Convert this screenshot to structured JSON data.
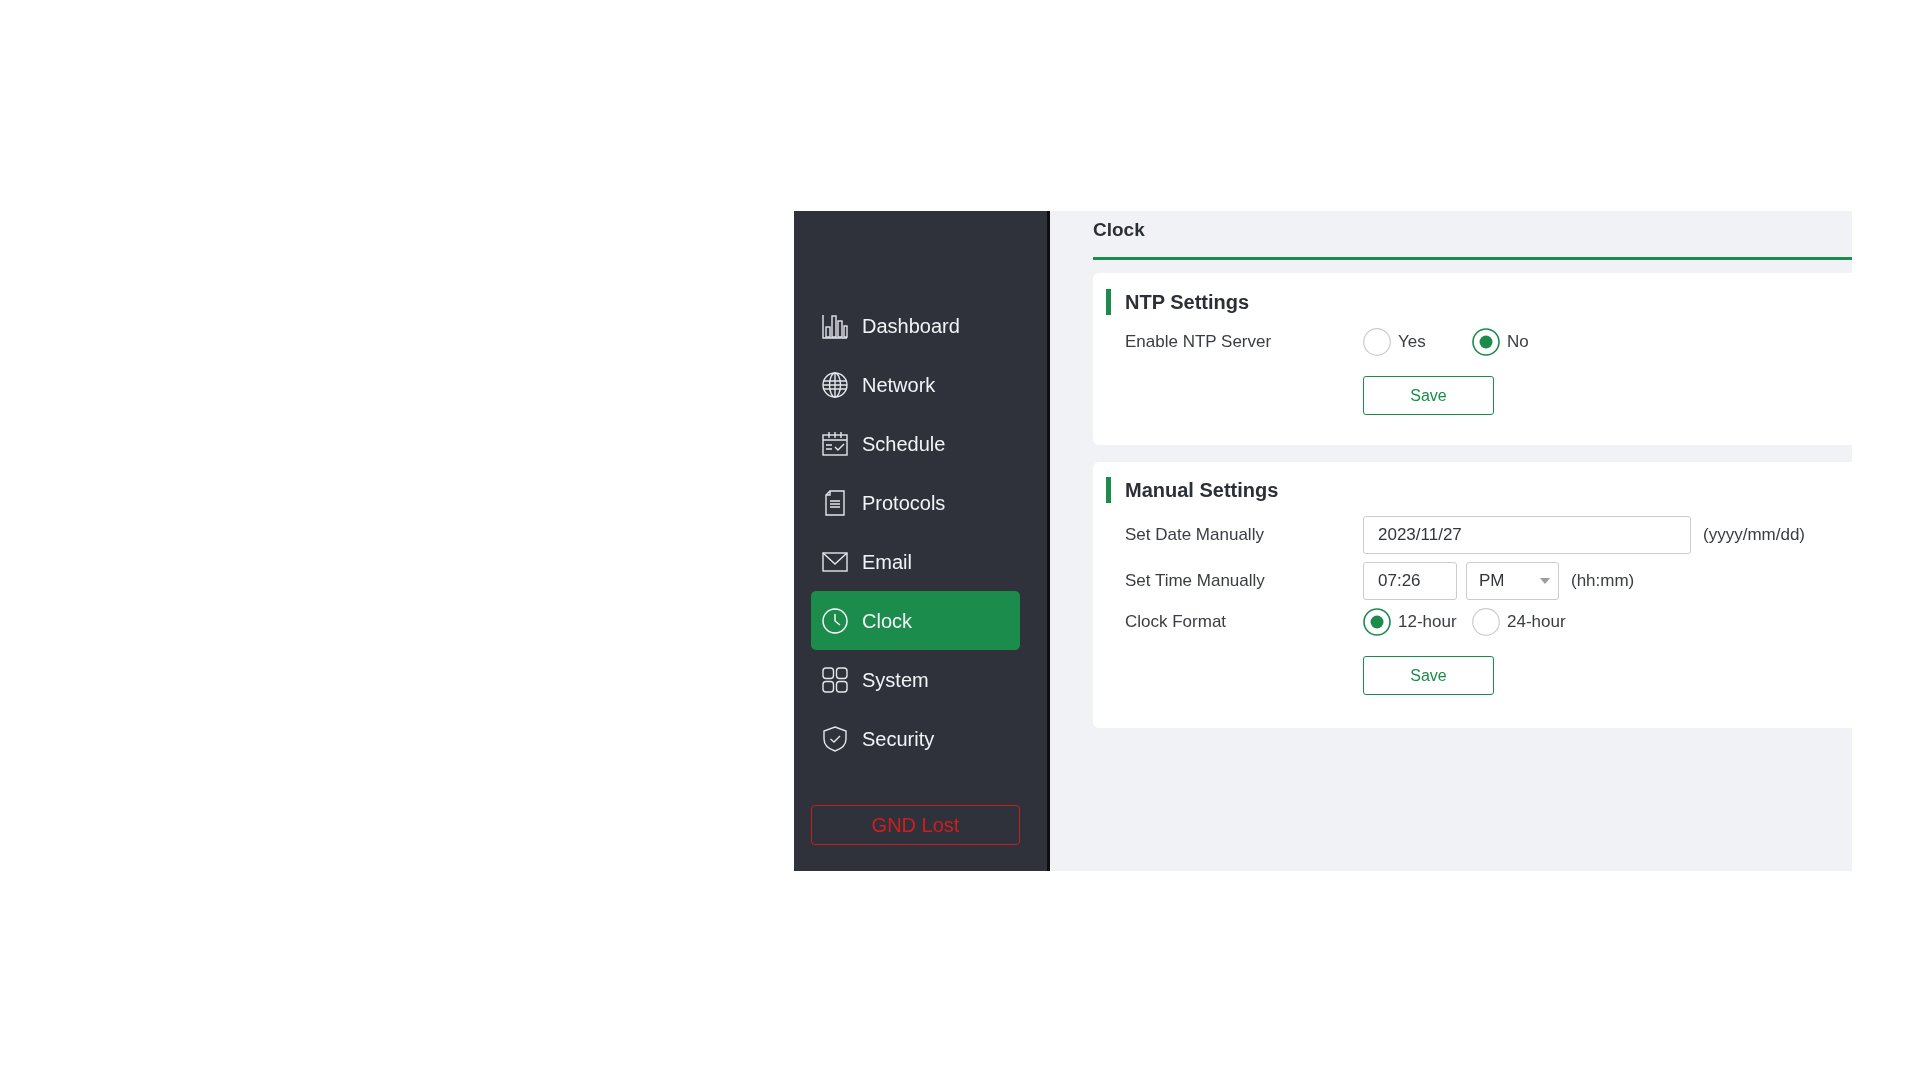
{
  "sidebar": {
    "items": [
      {
        "label": "Dashboard",
        "selected": false
      },
      {
        "label": "Network",
        "selected": false
      },
      {
        "label": "Schedule",
        "selected": false
      },
      {
        "label": "Protocols",
        "selected": false
      },
      {
        "label": "Email",
        "selected": false
      },
      {
        "label": "Clock",
        "selected": true
      },
      {
        "label": "System",
        "selected": false
      },
      {
        "label": "Security",
        "selected": false
      }
    ],
    "status_button": "GND Lost"
  },
  "page_title": "Clock",
  "sections": [
    {
      "title": "NTP Settings",
      "fields": [
        {
          "kind": "radio",
          "label": "Enable NTP Server",
          "options": [
            {
              "label": "Yes",
              "selected": false
            },
            {
              "label": "No",
              "selected": true
            }
          ]
        }
      ],
      "save_button": "Save"
    },
    {
      "title": "Manual Settings",
      "fields": [
        {
          "kind": "text",
          "label": "Set Date Manually",
          "value": "2023/11/27",
          "format_note": "(yyyy/mm/dd)"
        },
        {
          "kind": "time",
          "label": "Set Time Manually",
          "value": "07:26",
          "period": "PM",
          "format_note": "(hh:mm)"
        },
        {
          "kind": "radio",
          "label": "Clock Format",
          "options": [
            {
              "label": "12-hour",
              "selected": true
            },
            {
              "label": "24-hour",
              "selected": false
            }
          ]
        }
      ],
      "save_button": "Save"
    }
  ]
}
